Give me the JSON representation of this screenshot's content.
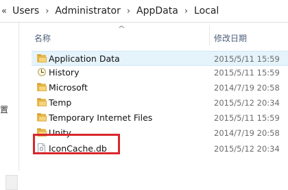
{
  "address": {
    "overflow": "«",
    "crumbs": [
      "Users",
      "Administrator",
      "AppData",
      "Local"
    ],
    "separator": "›"
  },
  "left_pane": {
    "partial_label": "置"
  },
  "columns": {
    "name": "名称",
    "date": "修改日期",
    "sort_indicator": "^"
  },
  "files": [
    {
      "name": "Application Data",
      "date": "2015/5/11 15:59",
      "icon": "folder-shortcut-icon"
    },
    {
      "name": "History",
      "date": "2015/5/11 15:59",
      "icon": "history-icon"
    },
    {
      "name": "Microsoft",
      "date": "2014/7/19 20:58",
      "icon": "folder-icon"
    },
    {
      "name": "Temp",
      "date": "2015/5/12 20:34",
      "icon": "folder-icon"
    },
    {
      "name": "Temporary Internet Files",
      "date": "2015/5/11 15:59",
      "icon": "folder-icon"
    },
    {
      "name": "Unity",
      "date": "2014/7/19 20:58",
      "icon": "folder-icon"
    },
    {
      "name": "IconCache.db",
      "date": "2015/5/12 20:34",
      "icon": "file-icon"
    }
  ],
  "highlight_color": "#d9262c",
  "selection_color": "#e5f3fb"
}
